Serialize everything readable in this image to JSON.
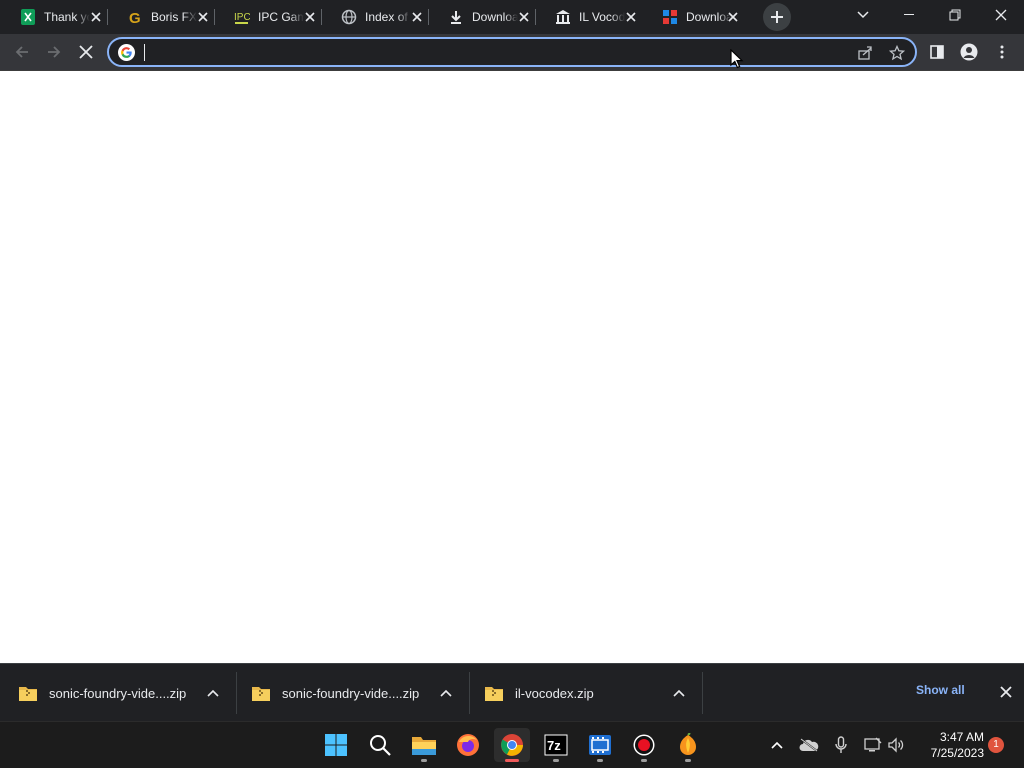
{
  "browser": {
    "tabs": [
      {
        "title": "Thank you",
        "favicon": "sheets-icon"
      },
      {
        "title": "Boris FX",
        "favicon": "g-logo-icon"
      },
      {
        "title": "IPC Games",
        "favicon": "ipc-games-icon"
      },
      {
        "title": "Index of",
        "favicon": "globe-icon"
      },
      {
        "title": "Download",
        "favicon": "download-icon"
      },
      {
        "title": "IL Vocodex",
        "favicon": "bank-icon"
      },
      {
        "title": "Download",
        "favicon": "download-site-icon"
      }
    ],
    "active_tab_index": 6,
    "omnibox": {
      "value": "",
      "placeholder": ""
    },
    "loading": true
  },
  "downloads": {
    "items": [
      {
        "name": "sonic-foundry-vide....zip",
        "icon": "zip-folder-icon"
      },
      {
        "name": "sonic-foundry-vide....zip",
        "icon": "zip-folder-icon"
      },
      {
        "name": "il-vocodex.zip",
        "icon": "zip-folder-icon"
      }
    ],
    "show_all_label": "Show all"
  },
  "taskbar": {
    "apps": [
      "windows-start-icon",
      "search-icon",
      "file-explorer-icon",
      "firefox-icon",
      "chrome-icon",
      "7zip-icon",
      "video-editor-icon",
      "record-icon",
      "fl-studio-icon"
    ],
    "active_app": "chrome-icon",
    "clock": {
      "time": "3:47 AM",
      "date": "7/25/2023"
    },
    "notification_count": "1"
  },
  "colors": {
    "tabstrip": "#202124",
    "toolbar": "#35363a",
    "omnibox_focus": "#8ab4f8",
    "link": "#8ab4f8",
    "taskbar": "#1c1c1c"
  }
}
